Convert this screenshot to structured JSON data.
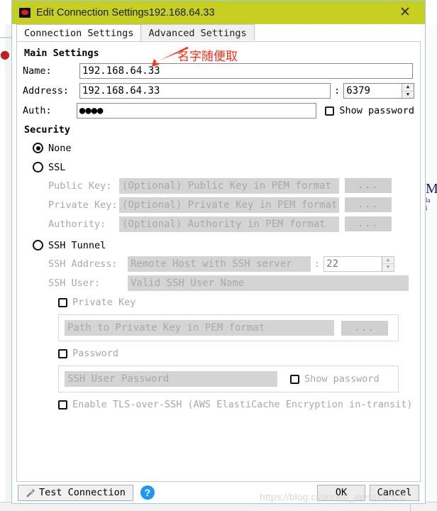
{
  "window": {
    "title": "Edit Connection Settings192.168.64.33",
    "icon": "redis-app-icon",
    "close_label": "✕"
  },
  "tabs": [
    {
      "label": "Connection Settings",
      "active": true
    },
    {
      "label": "Advanced Settings",
      "active": false
    }
  ],
  "main_settings": {
    "heading": "Main Settings",
    "name": {
      "label": "Name:",
      "value": "192.168.64.33"
    },
    "address": {
      "label": "Address:",
      "value": "192.168.64.33"
    },
    "separator": ":",
    "port": {
      "value": "6379"
    },
    "auth": {
      "label": "Auth:",
      "value": "●●●●"
    },
    "show_password": {
      "label": "Show password",
      "checked": false
    }
  },
  "security": {
    "heading": "Security",
    "options": [
      {
        "label": "None",
        "checked": true
      },
      {
        "label": "SSL",
        "checked": false
      },
      {
        "label": "SSH Tunnel",
        "checked": false
      }
    ],
    "ssl": {
      "public_key": {
        "label": "Public Key:",
        "placeholder": "(Optional) Public Key in PEM format",
        "value": ""
      },
      "private_key": {
        "label": "Private Key:",
        "placeholder": "(Optional) Private Key in PEM format",
        "value": ""
      },
      "authority": {
        "label": "Authority:",
        "placeholder": "(Optional) Authority in PEM format",
        "value": ""
      },
      "browse_label": "..."
    },
    "ssh": {
      "address": {
        "label": "SSH Address:",
        "placeholder": "Remote Host with SSH server",
        "value": ""
      },
      "separator": ":",
      "port": {
        "placeholder": "22",
        "value": ""
      },
      "user": {
        "label": "SSH User:",
        "placeholder": "Valid SSH User Name",
        "value": ""
      },
      "private_key_checkbox": {
        "label": "Private Key",
        "checked": false
      },
      "private_key_path": {
        "placeholder": "Path to Private Key in PEM format",
        "value": ""
      },
      "private_key_browse": "...",
      "password_checkbox": {
        "label": "Password",
        "checked": false
      },
      "password_field": {
        "placeholder": "SSH User Password",
        "value": ""
      },
      "show_password": {
        "label": "Show password",
        "checked": false
      },
      "tls_over_ssh": {
        "label": "Enable TLS-over-SSH (AWS ElastiCache Encryption in-transit)",
        "checked": false
      }
    }
  },
  "footer": {
    "test_connection": "Test Connection",
    "help": "?",
    "ok": "OK",
    "cancel": "Cancel"
  },
  "annotation": {
    "text": "名字随便取",
    "color": "#ff2b14"
  },
  "watermark": {
    "text": "https://blog.csdnnet/_awssssccat"
  },
  "background": {
    "right_text": "M",
    "right_sub1": "la",
    "right_sub2": "i"
  },
  "colors": {
    "titlebar": "#c6cf22",
    "accent_blue": "#2196f3",
    "annotation_red": "#ff2b14",
    "disabled_field": "#d4d4d4"
  }
}
